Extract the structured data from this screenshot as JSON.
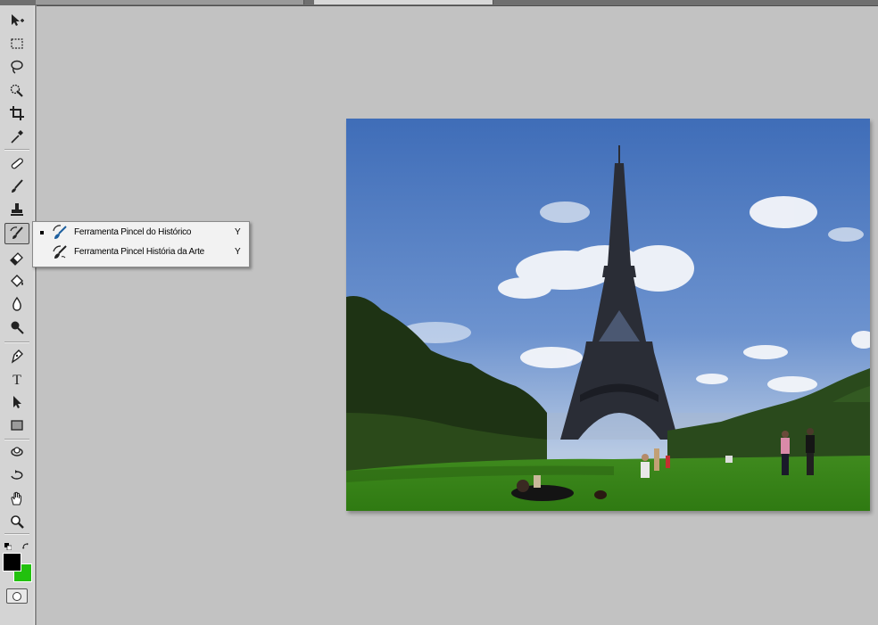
{
  "app": "Photoshop",
  "tools": [
    {
      "name": "move-tool",
      "icon": "move-icon"
    },
    {
      "name": "marquee-tool",
      "icon": "rect-marquee-icon"
    },
    {
      "name": "lasso-tool",
      "icon": "lasso-icon"
    },
    {
      "name": "quick-selection-tool",
      "icon": "quick-selection-icon"
    },
    {
      "name": "crop-tool",
      "icon": "crop-icon"
    },
    {
      "name": "eyedropper-tool",
      "icon": "eyedropper-icon"
    },
    {
      "name": "spot-healing-tool",
      "icon": "bandage-icon"
    },
    {
      "name": "brush-tool",
      "icon": "brush-icon"
    },
    {
      "name": "clone-stamp-tool",
      "icon": "stamp-icon"
    },
    {
      "name": "history-brush-tool",
      "icon": "history-brush-icon",
      "active": true
    },
    {
      "name": "eraser-tool",
      "icon": "eraser-icon"
    },
    {
      "name": "paint-bucket-tool",
      "icon": "bucket-icon"
    },
    {
      "name": "blur-tool",
      "icon": "drop-icon"
    },
    {
      "name": "dodge-tool",
      "icon": "dodge-icon"
    },
    {
      "name": "pen-tool",
      "icon": "pen-icon"
    },
    {
      "name": "type-tool",
      "icon": "type-icon",
      "glyph": "T"
    },
    {
      "name": "path-selection-tool",
      "icon": "arrow-icon"
    },
    {
      "name": "shape-tool",
      "icon": "rectangle-icon"
    },
    {
      "name": "3d-rotate-tool",
      "icon": "3d-rotate-icon"
    },
    {
      "name": "3d-orbit-tool",
      "icon": "3d-orbit-icon"
    },
    {
      "name": "hand-tool",
      "icon": "hand-icon"
    },
    {
      "name": "zoom-tool",
      "icon": "zoom-icon"
    }
  ],
  "colors": {
    "foreground": "#000000",
    "background": "#22c10e",
    "canvas": "#c2c2c2"
  },
  "flyout": {
    "items": [
      {
        "label": "Ferramenta Pincel do Histórico",
        "shortcut": "Y",
        "selected": true,
        "icon": "history-brush-icon"
      },
      {
        "label": "Ferramenta Pincel História da Arte",
        "shortcut": "Y",
        "selected": false,
        "icon": "art-history-brush-icon"
      }
    ]
  },
  "document": {
    "image": "eiffel-tower-photo"
  }
}
